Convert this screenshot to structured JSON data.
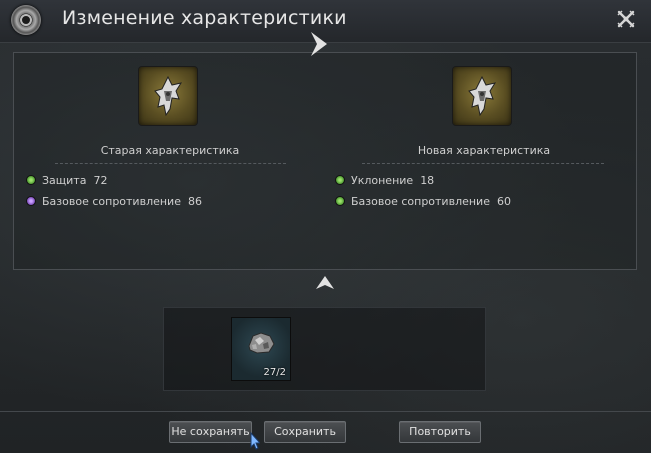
{
  "window": {
    "title": "Изменение характеристики",
    "close_icon": "crossed-swords-close-icon"
  },
  "old_stat": {
    "label": "Старая характеристика",
    "stats": [
      {
        "name": "Защита",
        "value": "72",
        "color": "green"
      },
      {
        "name": "Базовое сопротивление",
        "value": "86",
        "color": "purple"
      }
    ]
  },
  "new_stat": {
    "label": "Новая характеристика",
    "stats": [
      {
        "name": "Уклонение",
        "value": "18",
        "color": "green"
      },
      {
        "name": "Базовое сопротивление",
        "value": "60",
        "color": "green"
      }
    ]
  },
  "material": {
    "icon": "ore-icon",
    "count": "27/2"
  },
  "buttons": {
    "dont_save": "Не сохранять",
    "save": "Сохранить",
    "repeat": "Повторить"
  },
  "colors": {
    "stat_green": "#5ab83a",
    "stat_purple": "#9a6ad8",
    "item_frame_gold": "#8a7a3a"
  }
}
